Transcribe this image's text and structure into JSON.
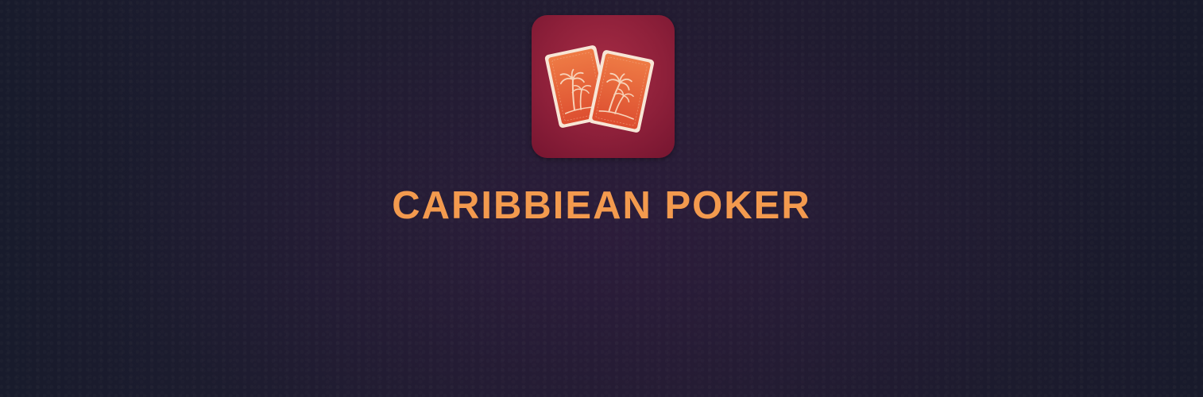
{
  "game": {
    "title": "CARIBBIEAN POKER",
    "icon": "playing-cards-palm-trees-icon"
  },
  "colors": {
    "title": "#f39a4e",
    "icon_background": "#8e203a",
    "card_face": "#e8603a",
    "card_border": "#f7e6d6"
  }
}
